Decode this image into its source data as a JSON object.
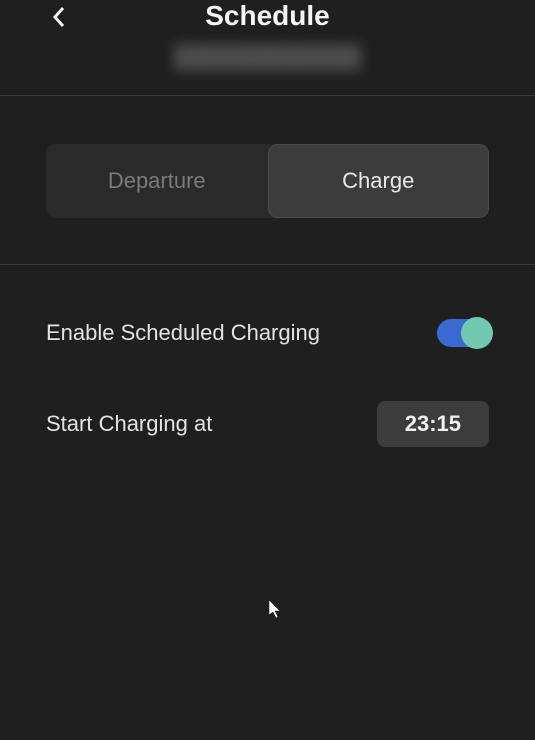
{
  "header": {
    "title": "Schedule",
    "subtitle": "████████████"
  },
  "tabs": {
    "departure": "Departure",
    "charge": "Charge"
  },
  "settings": {
    "enable_label": "Enable Scheduled Charging",
    "start_label": "Start Charging at",
    "start_time": "23:15"
  }
}
